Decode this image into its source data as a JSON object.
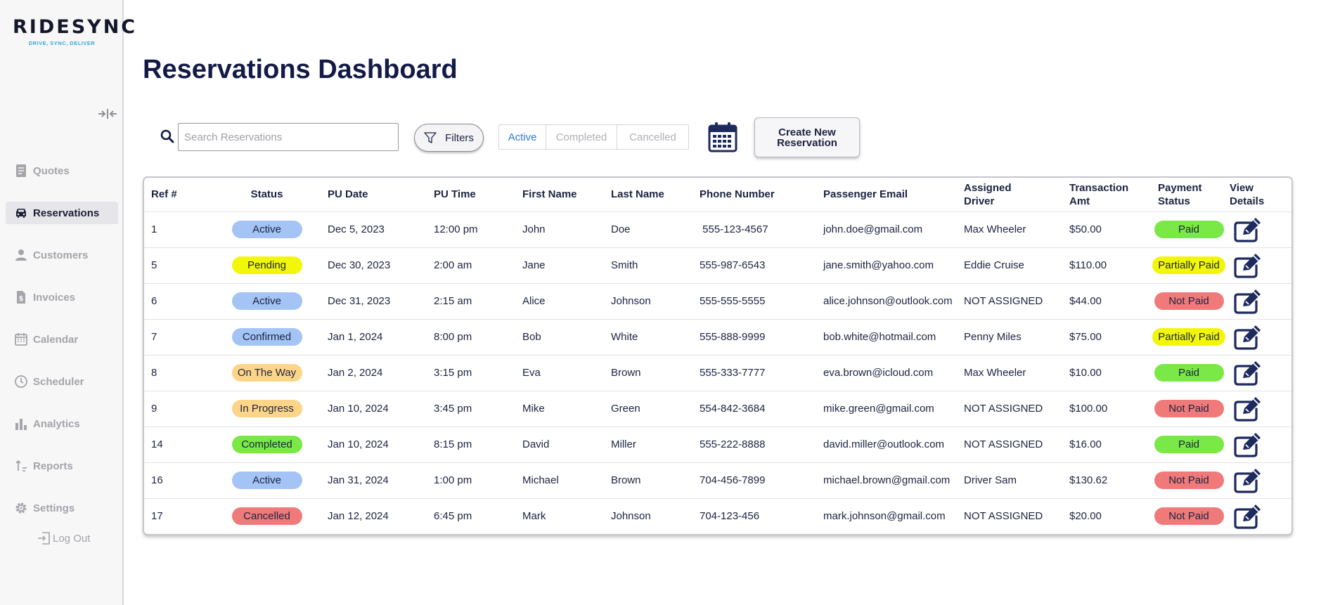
{
  "app": {
    "logo_text": "RIDESYNC",
    "logo_tagline": "DRIVE, SYNC, DELIVER"
  },
  "sidebar": {
    "items": [
      {
        "label": "Quotes",
        "icon": "quotes-icon",
        "active": false
      },
      {
        "label": "Reservations",
        "icon": "car-icon",
        "active": true
      },
      {
        "label": "Customers",
        "icon": "user-icon",
        "active": false
      },
      {
        "label": "Invoices",
        "icon": "invoice-icon",
        "active": false
      },
      {
        "label": "Calendar",
        "icon": "calendar-icon",
        "active": false
      },
      {
        "label": "Scheduler",
        "icon": "clock-icon",
        "active": false
      },
      {
        "label": "Analytics",
        "icon": "bar-chart-icon",
        "active": false
      },
      {
        "label": "Reports",
        "icon": "sort-arrows-icon",
        "active": false
      },
      {
        "label": "Settings",
        "icon": "gear-icon",
        "active": false
      }
    ],
    "logout_label": "Log Out"
  },
  "page": {
    "title": "Reservations Dashboard"
  },
  "toolbar": {
    "search_placeholder": "Search Reservations",
    "search_value": "",
    "filters_label": "Filters",
    "tabs": [
      {
        "label": "Active",
        "active": true
      },
      {
        "label": "Completed",
        "active": false
      },
      {
        "label": "Cancelled",
        "active": false
      }
    ],
    "create_label": "Create New\nReservation"
  },
  "colors": {
    "accent": "#2f7ad6",
    "title": "#131a48",
    "status_active": "#a3c4f5",
    "status_pending": "#f2f609",
    "status_confirmed": "#a3c4f5",
    "status_on_the_way": "#fdd589",
    "status_in_progress": "#fdd589",
    "status_completed": "#7ae846",
    "status_cancelled": "#f07a7a",
    "pay_paid": "#7ae846",
    "pay_partial": "#f2f609",
    "pay_not_paid": "#f07a7a"
  },
  "table": {
    "columns": [
      "Ref #",
      "Status",
      "PU Date",
      "PU Time",
      "First Name",
      "Last Name",
      "Phone Number",
      "Passenger Email",
      "Assigned\nDriver",
      "Transaction\nAmt",
      "Payment\nStatus",
      "View\nDetails"
    ],
    "rows": [
      {
        "ref": "1",
        "status": "Active",
        "status_color": "#a3c4f5",
        "date": "Dec 5, 2023",
        "time": "12:00 pm",
        "first": "John",
        "last": "Doe",
        "phone": " 555-123-4567",
        "email": "john.doe@gmail.com",
        "driver": "Max Wheeler",
        "amount": "$50.00",
        "payment": "Paid",
        "pay_color": "#7ae846"
      },
      {
        "ref": "5",
        "status": "Pending",
        "status_color": "#f2f609",
        "date": "Dec 30, 2023",
        "time": "2:00 am",
        "first": "Jane",
        "last": "Smith",
        "phone": "555-987-6543",
        "email": "jane.smith@yahoo.com",
        "driver": "Eddie Cruise",
        "amount": "$110.00",
        "payment": "Partially Paid",
        "pay_color": "#f2f609"
      },
      {
        "ref": "6",
        "status": "Active",
        "status_color": "#a3c4f5",
        "date": "Dec 31, 2023",
        "time": "2:15 am",
        "first": "Alice",
        "last": "Johnson",
        "phone": "555-555-5555",
        "email": "alice.johnson@outlook.com",
        "driver": "NOT ASSIGNED",
        "amount": "$44.00",
        "payment": "Not Paid",
        "pay_color": "#f07a7a"
      },
      {
        "ref": "7",
        "status": "Confirmed",
        "status_color": "#a3c4f5",
        "date": "Jan 1, 2024",
        "time": "8:00 pm",
        "first": "Bob",
        "last": "White",
        "phone": "555-888-9999",
        "email": "bob.white@hotmail.com",
        "driver": "Penny Miles",
        "amount": "$75.00",
        "payment": "Partially Paid",
        "pay_color": "#f2f609"
      },
      {
        "ref": "8",
        "status": "On The Way",
        "status_color": "#fdd589",
        "date": "Jan 2, 2024",
        "time": "3:15 pm",
        "first": "Eva",
        "last": "Brown",
        "phone": "555-333-7777",
        "email": "eva.brown@icloud.com",
        "driver": "Max Wheeler",
        "amount": "$10.00",
        "payment": "Paid",
        "pay_color": "#7ae846"
      },
      {
        "ref": "9",
        "status": "In Progress",
        "status_color": "#fdd589",
        "date": "Jan 10, 2024",
        "time": "3:45 pm",
        "first": "Mike",
        "last": "Green",
        "phone": "554-842-3684",
        "email": "mike.green@gmail.com",
        "driver": "NOT ASSIGNED",
        "amount": "$100.00",
        "payment": "Not Paid",
        "pay_color": "#f07a7a"
      },
      {
        "ref": "14",
        "status": "Completed",
        "status_color": "#7ae846",
        "date": "Jan 10, 2024",
        "time": "8:15 pm",
        "first": "David",
        "last": "Miller",
        "phone": "555-222-8888",
        "email": "david.miller@outlook.com",
        "driver": "NOT ASSIGNED",
        "amount": "$16.00",
        "payment": "Paid",
        "pay_color": "#7ae846"
      },
      {
        "ref": "16",
        "status": "Active",
        "status_color": "#a3c4f5",
        "date": "Jan 31, 2024",
        "time": "1:00 pm",
        "first": "Michael",
        "last": "Brown",
        "phone": "704-456-7899",
        "email": "michael.brown@gmail.com",
        "driver": "Driver Sam",
        "amount": "$130.62",
        "payment": "Not Paid",
        "pay_color": "#f07a7a"
      },
      {
        "ref": "17",
        "status": "Cancelled",
        "status_color": "#f07a7a",
        "date": "Jan 12, 2024",
        "time": "6:45 pm",
        "first": "Mark",
        "last": "Johnson",
        "phone": "704-123-456",
        "email": "mark.johnson@gmail.com",
        "driver": "NOT ASSIGNED",
        "amount": "$20.00",
        "payment": "Not Paid",
        "pay_color": "#f07a7a"
      }
    ]
  }
}
